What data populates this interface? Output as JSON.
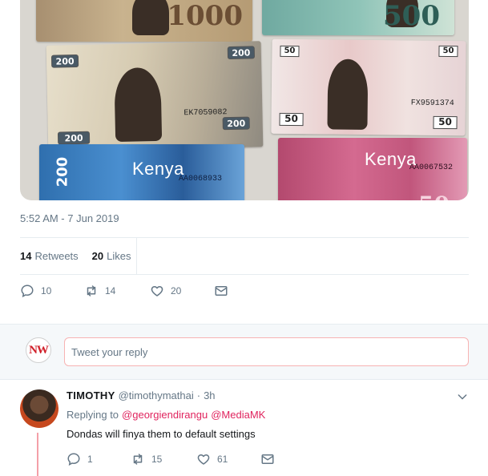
{
  "media": {
    "notes": {
      "n1000": {
        "value": "1000"
      },
      "n500": {
        "value": "500"
      },
      "n200": {
        "value": "200",
        "serial": "EK7059082"
      },
      "n50": {
        "value": "50",
        "serial": "FX9591374"
      },
      "nb200": {
        "brand": "Kenya",
        "value": "200",
        "serial": "AA0068933"
      },
      "nb50": {
        "brand": "Kenya",
        "value": "50",
        "serial": "AA0067532"
      }
    }
  },
  "tweet": {
    "timestamp": "5:52 AM - 7 Jun 2019",
    "retweets_count": "14",
    "retweets_label": "Retweets",
    "likes_count": "20",
    "likes_label": "Likes",
    "actions": {
      "reply": "10",
      "retweet": "14",
      "like": "20"
    }
  },
  "reply_box": {
    "avatar_initials": "NW",
    "placeholder": "Tweet your reply"
  },
  "reply": {
    "name": "TIMOTHY",
    "handle": "@timothymathai",
    "dot": "·",
    "time": "3h",
    "replying_label": "Replying to",
    "mentions": [
      "@georgiendirangu",
      "@MediaMK"
    ],
    "text": "Dondas will finya them to default settings",
    "actions": {
      "reply": "1",
      "retweet": "15",
      "like": "61"
    }
  },
  "colors": {
    "accent": "#e0245e",
    "muted": "#657786",
    "divider": "#e6ecf0",
    "thread_line": "#f4a0a8"
  }
}
